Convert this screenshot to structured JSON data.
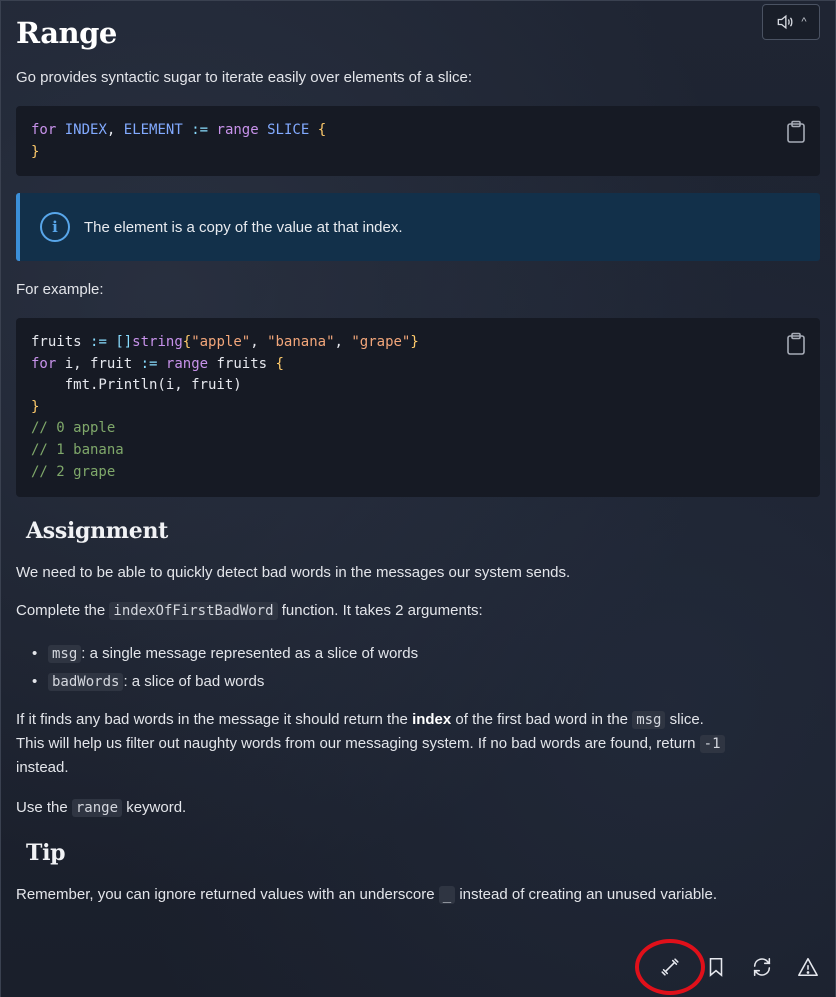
{
  "audio": {
    "chevron": "^"
  },
  "lesson": {
    "title": "Range",
    "intro": "Go provides syntactic sugar to iterate easily over elements of a slice:",
    "code1": {
      "line1": {
        "kw": "for",
        "a": "INDEX",
        "comma": ",",
        "b": "ELEMENT",
        "op": ":=",
        "kw2": "range",
        "c": "SLICE",
        "br": "{"
      },
      "line2": "}"
    },
    "note": "The element is a copy of the value at that index.",
    "example_label": "For example:",
    "code2": {
      "l1": {
        "a": "fruits",
        "op": ":=",
        "b": "[]",
        "ty": "string",
        "br1": "{",
        "s1": "\"apple\"",
        "c1": ", ",
        "s2": "\"banana\"",
        "c2": ", ",
        "s3": "\"grape\"",
        "br2": "}"
      },
      "l2": {
        "kw": "for",
        "a": "i, fruit",
        "op": ":=",
        "kw2": "range",
        "b": "fruits",
        "br": "{"
      },
      "l3": "fmt.Println(i, fruit)",
      "l4": "}",
      "l5": "// 0 apple",
      "l6": "// 1 banana",
      "l7": "// 2 grape"
    },
    "assignment_heading": "Assignment",
    "a1": "We need to be able to quickly detect bad words in the messages our system sends.",
    "a2_pre": "Complete the ",
    "a2_code": "indexOfFirstBadWord",
    "a2_post": " function. It takes 2 arguments:",
    "args": [
      {
        "code": "msg",
        "text": ": a single message represented as a slice of words"
      },
      {
        "code": "badWords",
        "text": ": a slice of bad words"
      }
    ],
    "a3_pre": "If it finds any bad words in the message it should return the ",
    "a3_bold": "index",
    "a3_mid": " of the first bad word in the ",
    "a3_code": "msg",
    "a3_post": " slice.",
    "a3_line2": "This will help us filter out naughty words from our messaging system. If no bad words are found, return ",
    "a3_code2": "-1",
    "a3_line3": "instead.",
    "a4_pre": "Use the ",
    "a4_code": "range",
    "a4_post": " keyword.",
    "tip_heading": "Tip",
    "tip_pre": "Remember, you can ignore returned values with an underscore ",
    "tip_code": "_",
    "tip_post": " instead of creating an unused variable."
  },
  "toolbar": [
    "dumbbell-icon",
    "bookmark-icon",
    "refresh-icon",
    "warning-icon"
  ],
  "colors": {
    "highlight": "#e0101a",
    "note_bg": "#12304a",
    "note_border": "#3b8fd8"
  }
}
